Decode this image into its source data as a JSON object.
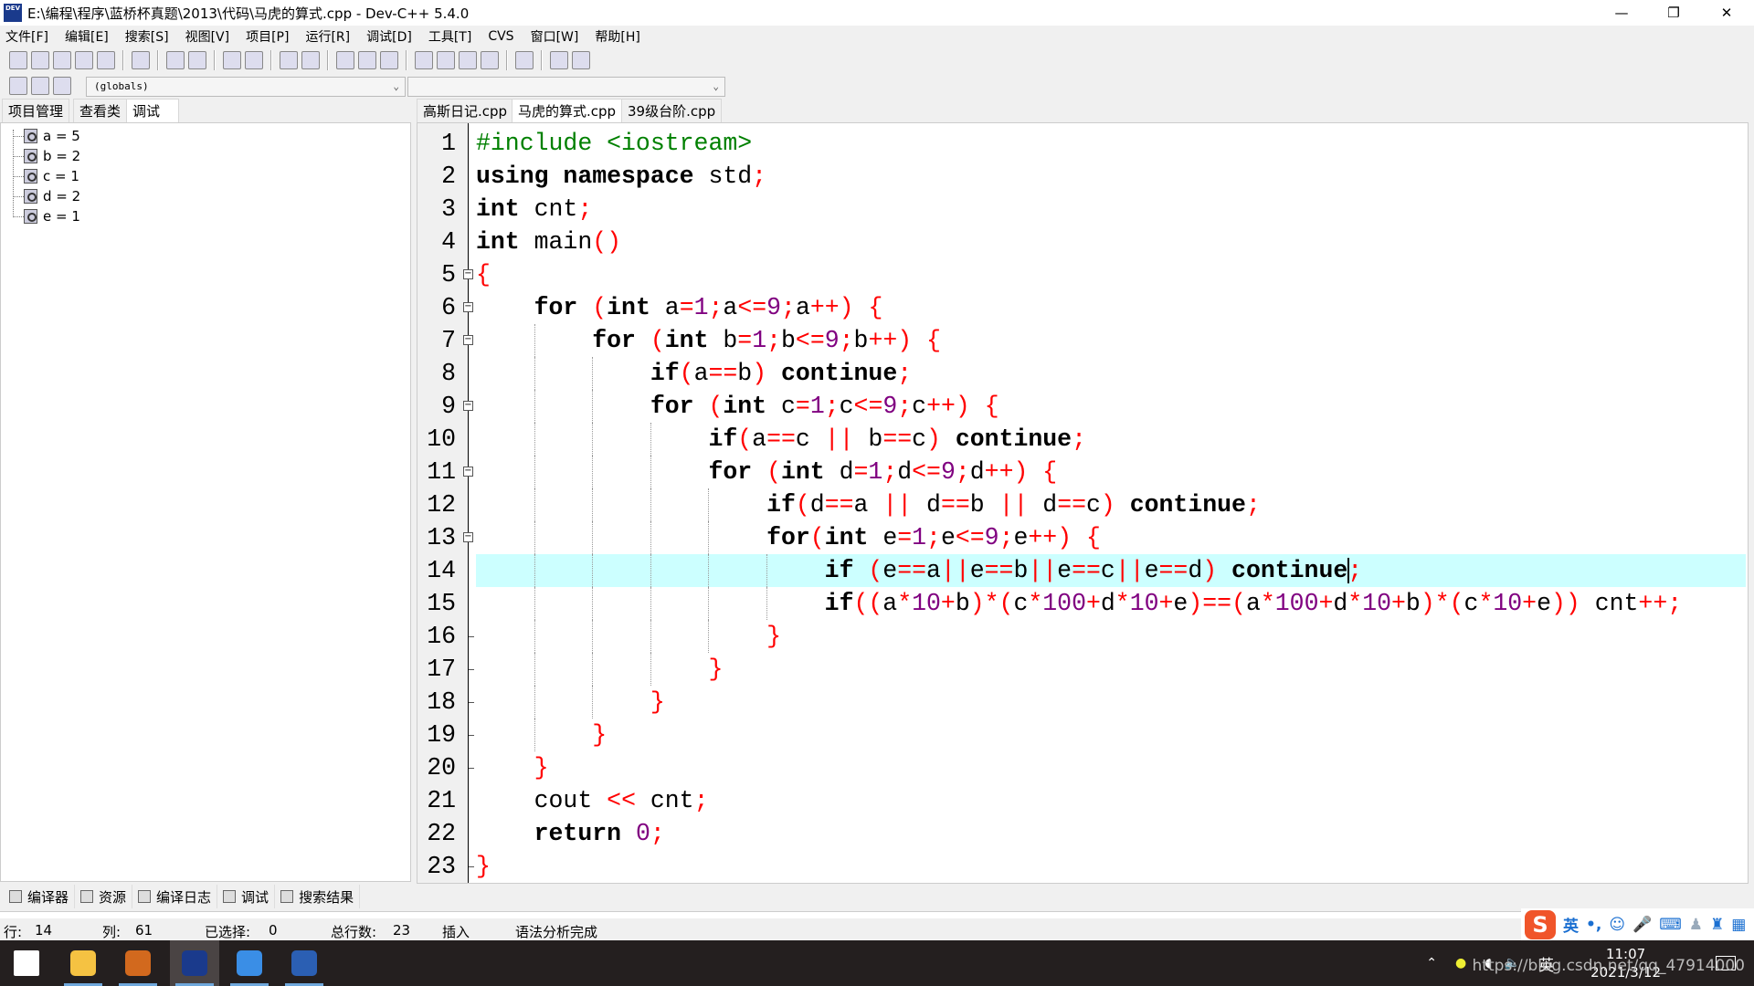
{
  "window": {
    "title": "E:\\编程\\程序\\蓝桥杯真题\\2013\\代码\\马虎的算式.cpp - Dev-C++ 5.4.0",
    "app_icon_text": "DEV"
  },
  "menu": [
    "文件[F]",
    "编辑[E]",
    "搜索[S]",
    "视图[V]",
    "项目[P]",
    "运行[R]",
    "调试[D]",
    "工具[T]",
    "CVS",
    "窗口[W]",
    "帮助[H]"
  ],
  "toolbar": [
    "new-file-icon",
    "open-file-icon",
    "save-icon",
    "save-all-icon",
    "close-file-icon",
    "|",
    "print-icon",
    "|",
    "undo-icon",
    "redo-icon",
    "|",
    "find-icon",
    "replace-icon",
    "|",
    "indent-icon",
    "unindent-icon",
    "|",
    "bookmark-prev-icon",
    "bookmark-next-icon",
    "goto-icon",
    "|",
    "compile-icon",
    "run-icon",
    "compile-run-icon",
    "rebuild-icon",
    "|",
    "syntax-check-icon",
    "|",
    "chart-icon",
    "stop-icon"
  ],
  "toolbar2": [
    "project-new-icon",
    "project-add-icon",
    "project-options-icon"
  ],
  "scope_combo": {
    "value": "(globals)"
  },
  "members_combo": {
    "value": ""
  },
  "left_tabs": [
    {
      "label": "项目管理"
    },
    {
      "label": "查看类"
    },
    {
      "label": "调试",
      "active": true
    }
  ],
  "watch": [
    "a = 5",
    "b = 2",
    "c = 1",
    "d = 2",
    "e = 1"
  ],
  "file_tabs": [
    {
      "label": "高斯日记.cpp"
    },
    {
      "label": "马虎的算式.cpp",
      "active": true
    },
    {
      "label": "39级台阶.cpp"
    }
  ],
  "code": {
    "lines": [
      "#include <iostream>",
      "using namespace std;",
      "int cnt;",
      "int main()",
      "{",
      "    for (int a=1;a<=9;a++) {",
      "        for (int b=1;b<=9;b++) {",
      "            if(a==b) continue;",
      "            for (int c=1;c<=9;c++) {",
      "                if(a==c || b==c) continue;",
      "                for (int d=1;d<=9;d++) {",
      "                    if(d==a || d==b || d==c) continue;",
      "                    for(int e=1;e<=9;e++) {",
      "                        if (e==a||e==b||e==c||e==d) continue;",
      "                        if((a*10+b)*(c*100+d*10+e)==(a*100+d*10+b)*(c*10+e)) cnt++;",
      "                    }",
      "                }",
      "            }",
      "        }",
      "    }",
      "    cout << cnt;",
      "    return 0;",
      "}"
    ],
    "current_line": 14,
    "current_col": 61,
    "fold_open_lines": [
      5,
      6,
      7,
      9,
      11,
      13
    ],
    "fold_end_lines": [
      16,
      17,
      18,
      19,
      20,
      23
    ],
    "colors": {
      "keyword": "#000000",
      "number": "#800080",
      "operator": "#ff0000",
      "preprocessor": "#008000",
      "current_line": "#ccffff"
    }
  },
  "bottom_tabs": [
    {
      "label": "编译器",
      "icon": "compiler-icon"
    },
    {
      "label": "资源",
      "icon": "resources-icon"
    },
    {
      "label": "编译日志",
      "icon": "compile-log-icon"
    },
    {
      "label": "调试",
      "icon": "debug-check-icon"
    },
    {
      "label": "搜索结果",
      "icon": "search-results-icon"
    }
  ],
  "status": {
    "row_label": "行:",
    "row": "14",
    "col_label": "列:",
    "col": "61",
    "sel_label": "已选择:",
    "sel": "0",
    "total_label": "总行数:",
    "total": "23",
    "mode": "插入",
    "message": "语法分析完成"
  },
  "ime": {
    "lang": "英",
    "punct": "•,"
  },
  "taskbar": {
    "apps": [
      "start-icon",
      "file-explorer-icon",
      "photo-app-icon",
      "devcpp-icon",
      "sogou-browser-icon",
      "word-icon"
    ],
    "tray_lang": "英",
    "time": "11:07",
    "date": "2021/3/12",
    "watermark": "https://blog.csdn.net/qq_47914000"
  }
}
